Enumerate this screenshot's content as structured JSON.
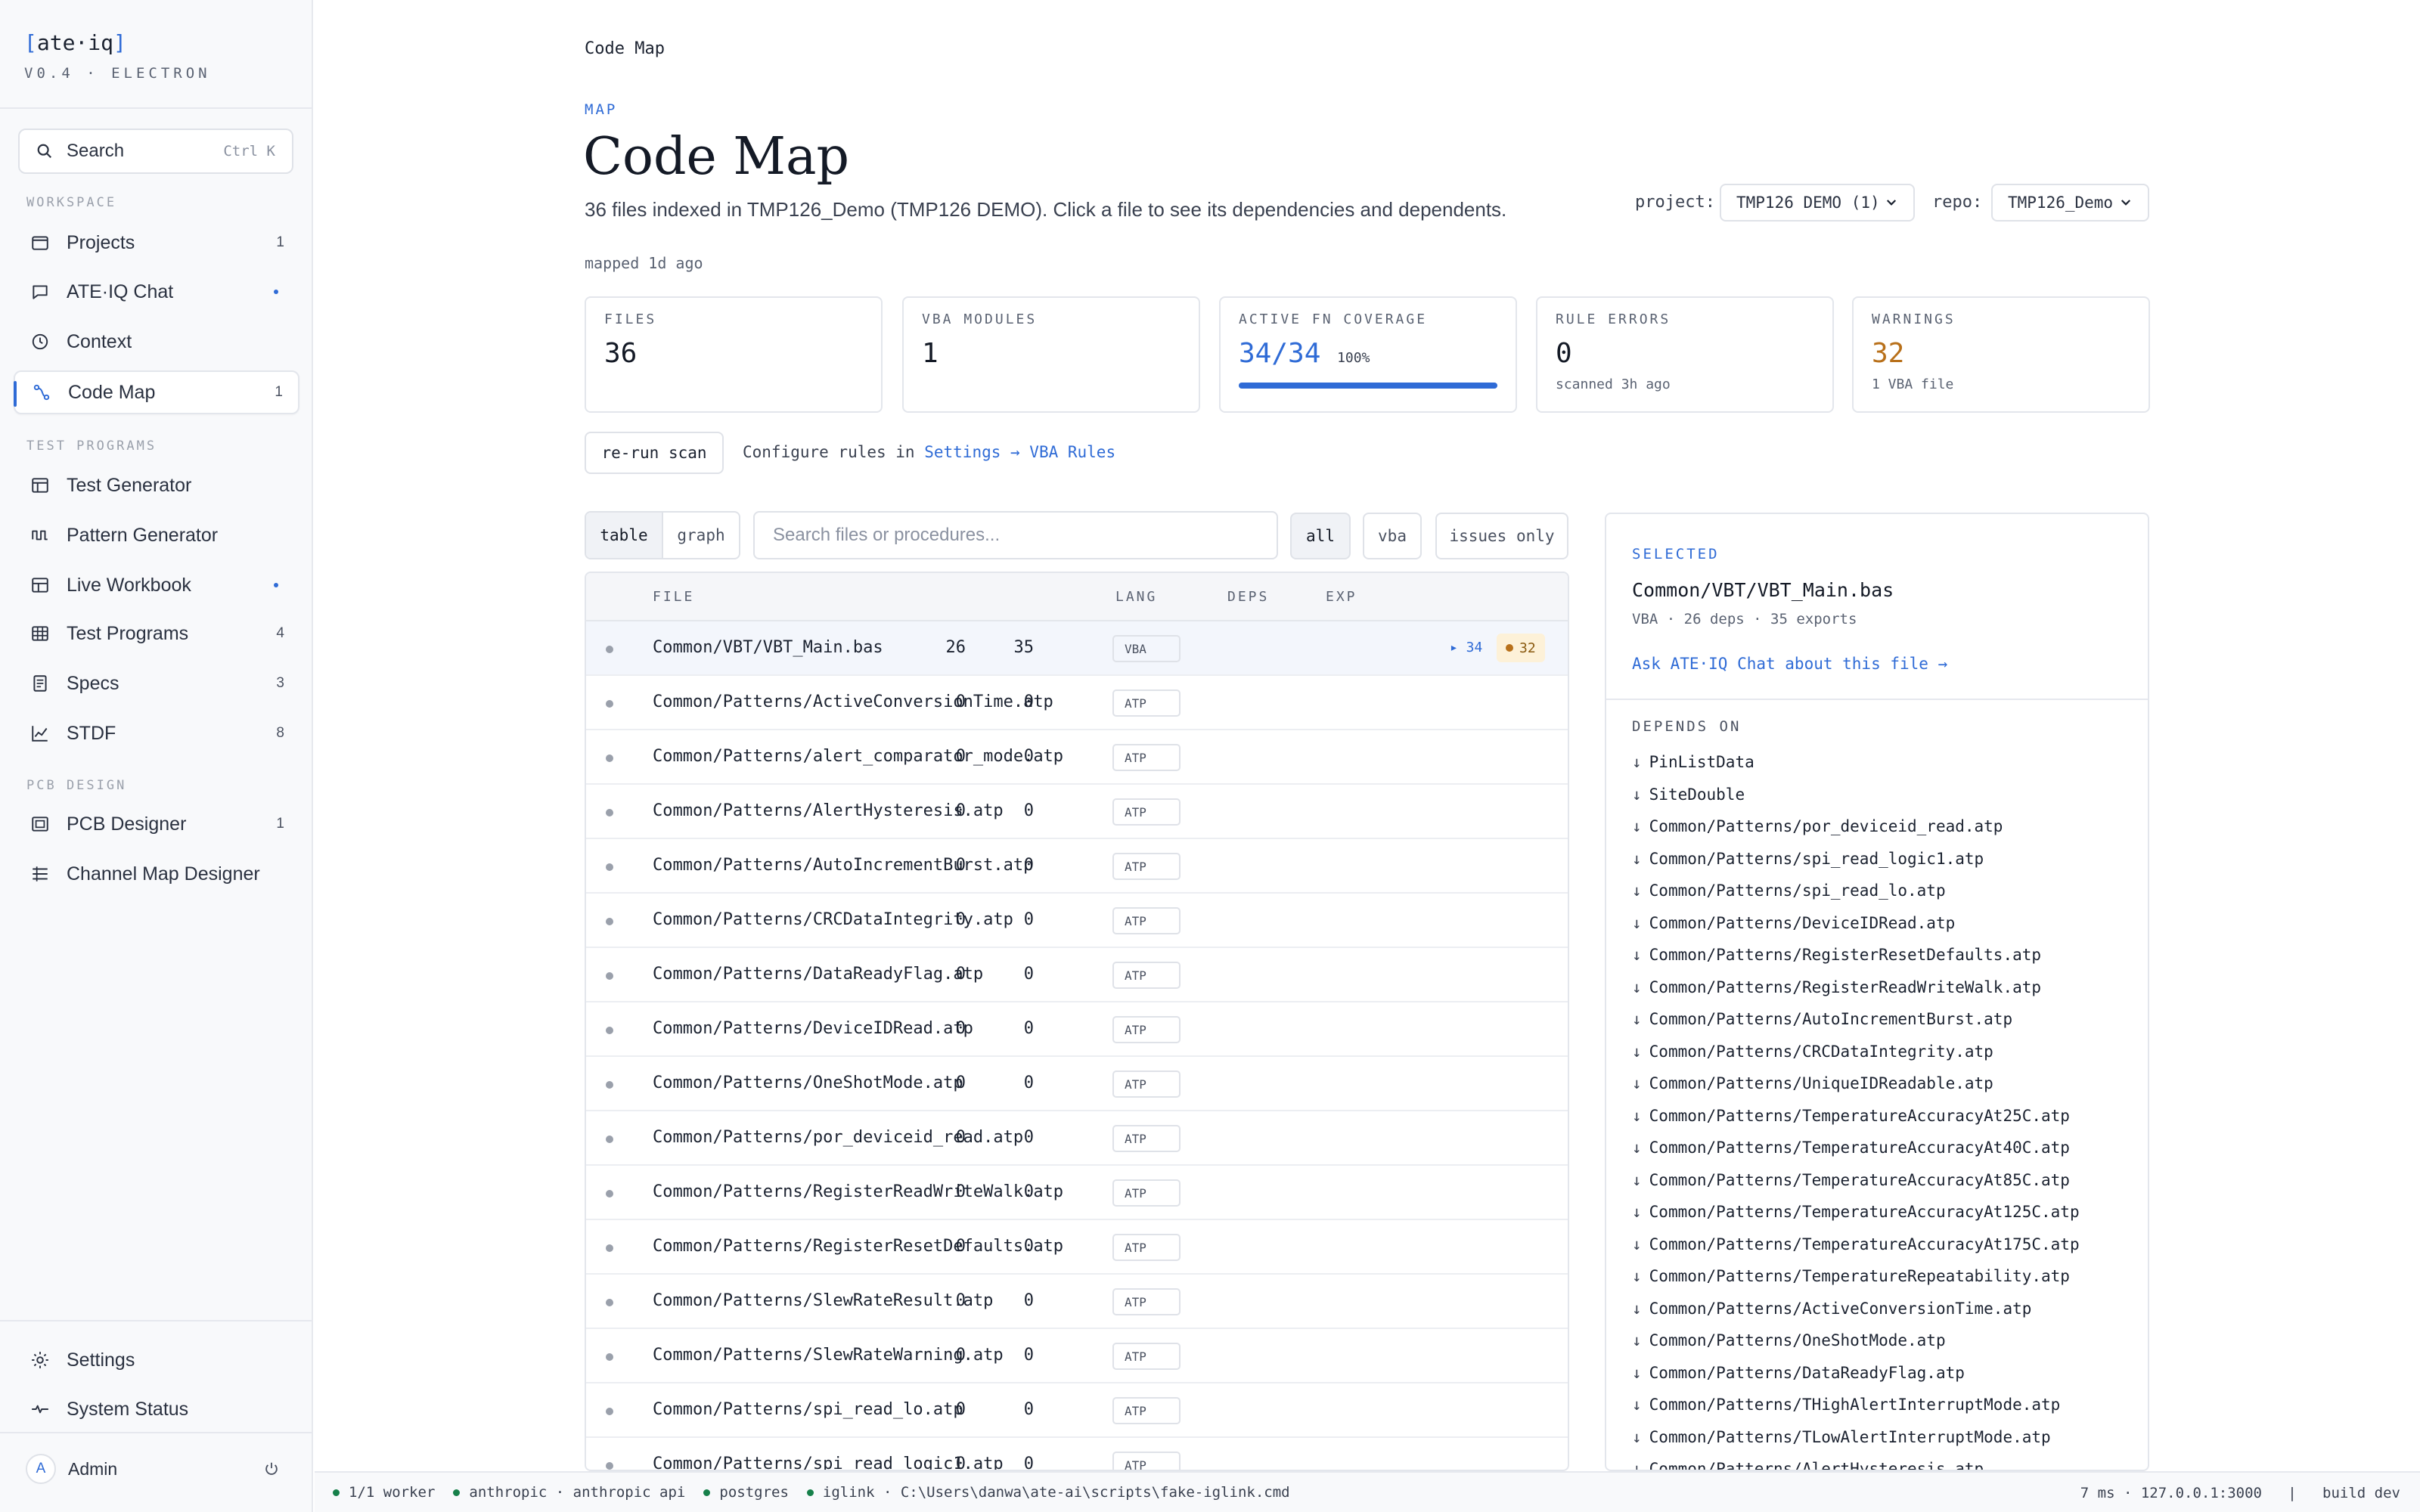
{
  "brand": {
    "name_open": "[",
    "name": "ate·iq",
    "name_close": "]",
    "version": "V0.4 · ELECTRON"
  },
  "sidebar": {
    "search_label": "Search",
    "search_shortcut": "Ctrl K",
    "sections": {
      "workspace": "WORKSPACE",
      "test_programs": "TEST PROGRAMS",
      "pcb_design": "PCB DESIGN"
    },
    "items": [
      {
        "label": "Projects",
        "count": "1"
      },
      {
        "label": "ATE·IQ Chat",
        "count": ""
      },
      {
        "label": "Context",
        "count": ""
      },
      {
        "label": "Code Map",
        "count": "1"
      },
      {
        "label": "Test Generator",
        "count": ""
      },
      {
        "label": "Pattern Generator",
        "count": ""
      },
      {
        "label": "Live Workbook",
        "count": ""
      },
      {
        "label": "Test Programs",
        "count": "4"
      },
      {
        "label": "Specs",
        "count": "3"
      },
      {
        "label": "STDF",
        "count": "8"
      },
      {
        "label": "PCB Designer",
        "count": "1"
      },
      {
        "label": "Channel Map Designer",
        "count": ""
      }
    ],
    "settings": "Settings",
    "system_status": "System Status",
    "admin_initial": "A",
    "admin": "Admin"
  },
  "breadcrumb": "Code Map",
  "header": {
    "eyebrow": "MAP",
    "title": "Code Map",
    "description": "36 files indexed in TMP126_Demo (TMP126 DEMO). Click a file to see its dependencies and dependents.",
    "mapped": "mapped 1d ago",
    "project_label": "project:",
    "project_value": "TMP126 DEMO (1)",
    "repo_label": "repo:",
    "repo_value": "TMP126_Demo"
  },
  "stats": {
    "files": {
      "label": "FILES",
      "value": "36"
    },
    "vba": {
      "label": "VBA MODULES",
      "value": "1"
    },
    "coverage": {
      "label": "ACTIVE FN COVERAGE",
      "value": "34/34",
      "pct": "100%",
      "fraction": 1.0
    },
    "errors": {
      "label": "RULE ERRORS",
      "value": "0",
      "sub": "scanned 3h ago"
    },
    "warnings": {
      "label": "WARNINGS",
      "value": "32",
      "sub": "1 VBA file"
    }
  },
  "actions": {
    "rerun": "re-run scan",
    "config_prefix": "Configure rules in",
    "config_link": "Settings → VBA Rules"
  },
  "toolbar": {
    "view_table": "table",
    "view_graph": "graph",
    "search_placeholder": "Search files or procedures...",
    "filter_all": "all",
    "filter_vba": "vba",
    "filter_issues": "issues only"
  },
  "table": {
    "headers": {
      "file": "FILE",
      "lang": "LANG",
      "deps": "DEPS",
      "exp": "EXP"
    },
    "rows": [
      {
        "file": "Common/VBT/VBT_Main.bas",
        "lang": "VBA",
        "deps": "26",
        "exp": "35",
        "fn": "▸ 34",
        "warn": "32"
      },
      {
        "file": "Common/Patterns/ActiveConversionTime.atp",
        "lang": "ATP",
        "deps": "0",
        "exp": "0"
      },
      {
        "file": "Common/Patterns/alert_comparator_mode.atp",
        "lang": "ATP",
        "deps": "0",
        "exp": "0"
      },
      {
        "file": "Common/Patterns/AlertHysteresis.atp",
        "lang": "ATP",
        "deps": "0",
        "exp": "0"
      },
      {
        "file": "Common/Patterns/AutoIncrementBurst.atp",
        "lang": "ATP",
        "deps": "0",
        "exp": "0"
      },
      {
        "file": "Common/Patterns/CRCDataIntegrity.atp",
        "lang": "ATP",
        "deps": "0",
        "exp": "0"
      },
      {
        "file": "Common/Patterns/DataReadyFlag.atp",
        "lang": "ATP",
        "deps": "0",
        "exp": "0"
      },
      {
        "file": "Common/Patterns/DeviceIDRead.atp",
        "lang": "ATP",
        "deps": "0",
        "exp": "0"
      },
      {
        "file": "Common/Patterns/OneShotMode.atp",
        "lang": "ATP",
        "deps": "0",
        "exp": "0"
      },
      {
        "file": "Common/Patterns/por_deviceid_read.atp",
        "lang": "ATP",
        "deps": "0",
        "exp": "0"
      },
      {
        "file": "Common/Patterns/RegisterReadWriteWalk.atp",
        "lang": "ATP",
        "deps": "0",
        "exp": "0"
      },
      {
        "file": "Common/Patterns/RegisterResetDefaults.atp",
        "lang": "ATP",
        "deps": "0",
        "exp": "0"
      },
      {
        "file": "Common/Patterns/SlewRateResult.atp",
        "lang": "ATP",
        "deps": "0",
        "exp": "0"
      },
      {
        "file": "Common/Patterns/SlewRateWarning.atp",
        "lang": "ATP",
        "deps": "0",
        "exp": "0"
      },
      {
        "file": "Common/Patterns/spi_read_lo.atp",
        "lang": "ATP",
        "deps": "0",
        "exp": "0"
      },
      {
        "file": "Common/Patterns/spi_read_logic1.atp",
        "lang": "ATP",
        "deps": "0",
        "exp": "0"
      }
    ]
  },
  "detail": {
    "selected_label": "SELECTED",
    "file": "Common/VBT/VBT_Main.bas",
    "meta": "VBA · 26 deps · 35 exports",
    "ask": "Ask ATE·IQ Chat about this file →",
    "depends_label": "DEPENDS ON",
    "depends": [
      "PinListData",
      "SiteDouble",
      "Common/Patterns/por_deviceid_read.atp",
      "Common/Patterns/spi_read_logic1.atp",
      "Common/Patterns/spi_read_lo.atp",
      "Common/Patterns/DeviceIDRead.atp",
      "Common/Patterns/RegisterResetDefaults.atp",
      "Common/Patterns/RegisterReadWriteWalk.atp",
      "Common/Patterns/AutoIncrementBurst.atp",
      "Common/Patterns/CRCDataIntegrity.atp",
      "Common/Patterns/UniqueIDReadable.atp",
      "Common/Patterns/TemperatureAccuracyAt25C.atp",
      "Common/Patterns/TemperatureAccuracyAt40C.atp",
      "Common/Patterns/TemperatureAccuracyAt85C.atp",
      "Common/Patterns/TemperatureAccuracyAt125C.atp",
      "Common/Patterns/TemperatureAccuracyAt175C.atp",
      "Common/Patterns/TemperatureRepeatability.atp",
      "Common/Patterns/ActiveConversionTime.atp",
      "Common/Patterns/OneShotMode.atp",
      "Common/Patterns/DataReadyFlag.atp",
      "Common/Patterns/THighAlertInterruptMode.atp",
      "Common/Patterns/TLowAlertInterruptMode.atp",
      "Common/Patterns/AlertHysteresis.atp"
    ]
  },
  "statusbar": {
    "worker": "1/1 worker",
    "anthropic": "anthropic · anthropic api",
    "postgres": "postgres",
    "iglink": "iglink · C:\\Users\\danwa\\ate-ai\\scripts\\fake-iglink.cmd",
    "right": "7 ms · 127.0.0.1:3000   |   build dev"
  },
  "colors": {
    "accent": "#2f6bd6",
    "warning": "#b8701a",
    "ok": "#16804a"
  }
}
